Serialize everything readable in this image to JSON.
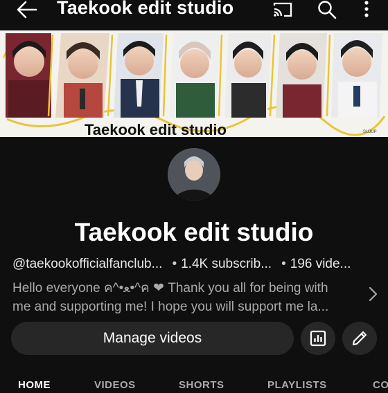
{
  "topbar": {
    "title": "Taekook edit studio",
    "icons": [
      "back-arrow-icon",
      "cast-icon",
      "search-icon",
      "more-vert-icon"
    ]
  },
  "banner": {
    "caption": "Taekook edit studio",
    "small_tag": "SUJUP"
  },
  "channel": {
    "name": "Taekook edit studio",
    "handle": "@taekookofficialfanclub...",
    "subscribers": "1.4K subscrib...",
    "videos": "196 vide...",
    "description_line1": "Hello everyone ค^•ﻌ•^ค ❤ Thank you all for being with",
    "description_line2": "me and supporting me! I hope you will support me la..."
  },
  "actions": {
    "manage_label": "Manage videos"
  },
  "tabs": [
    {
      "label": "HOME",
      "active": true
    },
    {
      "label": "VIDEOS",
      "active": false
    },
    {
      "label": "SHORTS",
      "active": false
    },
    {
      "label": "PLAYLISTS",
      "active": false
    },
    {
      "label": "CO",
      "active": false
    }
  ],
  "colors": {
    "background": "#0f0f0f",
    "button": "#272727",
    "secondary_text": "#aaaaaa",
    "banner_accent": "#e7c53a"
  }
}
